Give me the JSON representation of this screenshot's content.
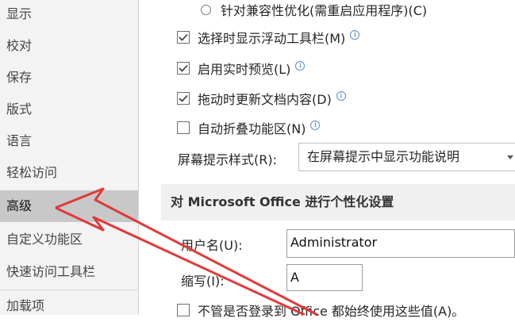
{
  "sidebar": {
    "items": [
      {
        "label": "显示"
      },
      {
        "label": "校对"
      },
      {
        "label": "保存"
      },
      {
        "label": "版式"
      },
      {
        "label": "语言"
      },
      {
        "label": "轻松访问"
      },
      {
        "label": "高级",
        "active": true
      },
      {
        "label": "自定义功能区"
      },
      {
        "label": "快速访问工具栏"
      },
      {
        "label": "加载项"
      }
    ]
  },
  "options": {
    "compat_radio": "针对兼容性优化(需重启应用程序)(C)",
    "show_floating_toolbar": {
      "label": "选择时显示浮动工具栏(M)",
      "checked": true
    },
    "live_preview": {
      "label": "启用实时预览(L)",
      "checked": true
    },
    "update_while_drag": {
      "label": "拖动时更新文档内容(D)",
      "checked": true
    },
    "auto_collapse_ribbon": {
      "label": "自动折叠功能区(N)",
      "checked": false
    }
  },
  "screentip": {
    "label": "屏幕提示样式(R):",
    "value": "在屏幕提示中显示功能说明"
  },
  "personalize": {
    "heading": "对 Microsoft Office 进行个性化设置",
    "username_label": "用户名(U):",
    "username_value": "Administrator",
    "initials_label": "缩写(I):",
    "initials_value": "A",
    "always_use_label": "不管是否登录到 Office 都始终使用这些值(A)。"
  },
  "icons": {
    "info": "info-icon",
    "check": "checkmark-icon"
  },
  "colors": {
    "annotation_arrow": "#e03a3a",
    "active_item_bg": "#c8c8c8"
  }
}
